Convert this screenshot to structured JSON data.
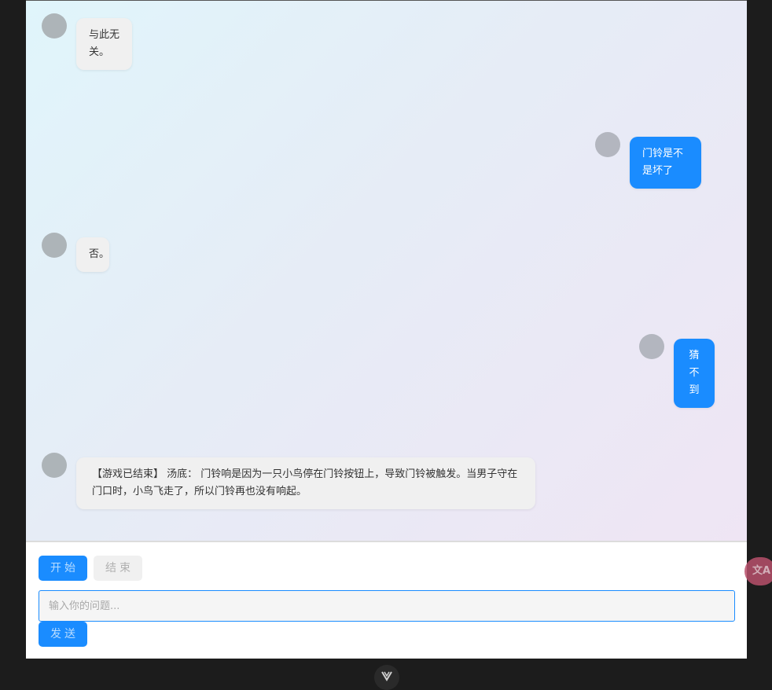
{
  "messages": [
    {
      "role": "bot",
      "text": "与此无关。"
    },
    {
      "role": "user",
      "text": "门铃是不是坏了"
    },
    {
      "role": "bot",
      "text": "否。"
    },
    {
      "role": "user",
      "text": "猜不到"
    },
    {
      "role": "bot",
      "text": "【游戏已结束】 汤底： 门铃响是因为一只小鸟停在门铃按钮上，导致门铃被触发。当男子守在门口时，小鸟飞走了，所以门铃再也没有响起。"
    }
  ],
  "controls": {
    "start_label": "开始",
    "end_label": "结束",
    "send_label": "发送"
  },
  "input": {
    "placeholder": "输入你的问题...",
    "value": ""
  },
  "floating": {
    "translate_label": "文A"
  },
  "colors": {
    "accent": "#1a8cff",
    "bot_bubble": "#f0f0f0",
    "frame": "#1c1c1c"
  }
}
